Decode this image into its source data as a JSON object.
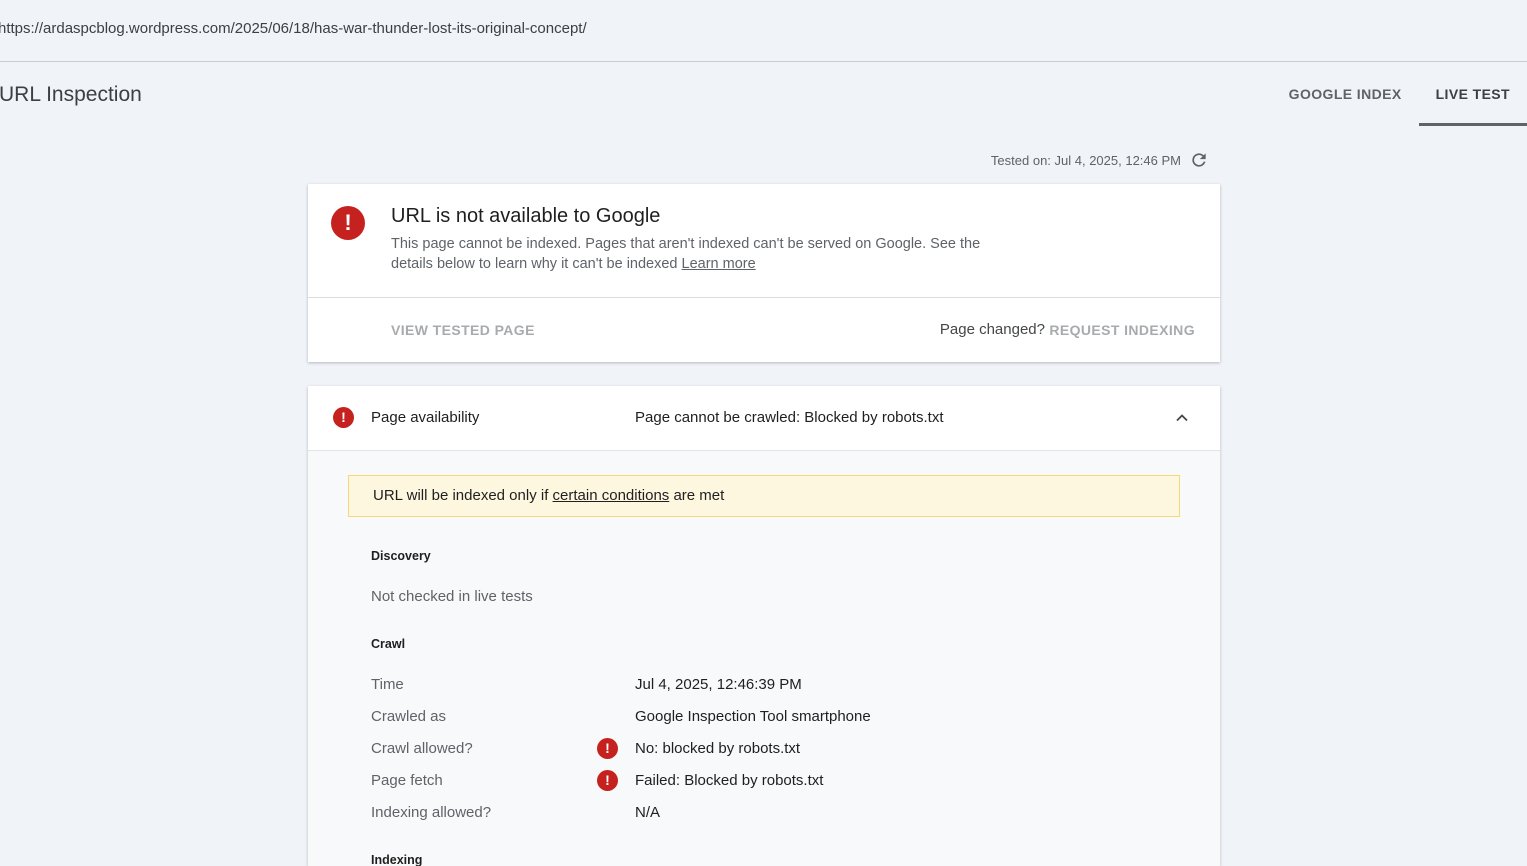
{
  "address_bar": {
    "url": "https://ardaspcblog.wordpress.com/2025/06/18/has-war-thunder-lost-its-original-concept/"
  },
  "header": {
    "title": "URL Inspection",
    "tabs": [
      {
        "label": "GOOGLE INDEX",
        "active": false
      },
      {
        "label": "LIVE TEST",
        "active": true
      }
    ]
  },
  "tested_on": "Tested on: Jul 4, 2025, 12:46 PM",
  "summary": {
    "icon": "error-icon",
    "headline": "URL is not available to Google",
    "description": "This page cannot be indexed. Pages that aren't indexed can't be served on Google. See the details below to learn why it can't be indexed",
    "learn_more": "Learn more",
    "view_tested_page": "VIEW TESTED PAGE",
    "page_changed": "Page changed?",
    "request_indexing": "REQUEST INDEXING"
  },
  "availability": {
    "label": "Page availability",
    "status": "Page cannot be crawled: Blocked by robots.txt",
    "notice_prefix": "URL will be indexed only if",
    "notice_link": "certain conditions",
    "notice_suffix": "are met",
    "discovery": {
      "title": "Discovery",
      "text": "Not checked in live tests"
    },
    "crawl": {
      "title": "Crawl",
      "rows": [
        {
          "key": "Time",
          "value": "Jul 4, 2025, 12:46:39 PM",
          "error": false
        },
        {
          "key": "Crawled as",
          "value": "Google Inspection Tool smartphone",
          "error": false
        },
        {
          "key": "Crawl allowed?",
          "value": "No: blocked by robots.txt",
          "error": true
        },
        {
          "key": "Page fetch",
          "value": "Failed: Blocked by robots.txt",
          "error": true
        },
        {
          "key": "Indexing allowed?",
          "value": "N/A",
          "error": false
        }
      ]
    },
    "indexing": {
      "title": "Indexing"
    }
  },
  "colors": {
    "error": "#c5221f",
    "notice_bg": "#fef7e0",
    "background": "#f0f4f9"
  }
}
